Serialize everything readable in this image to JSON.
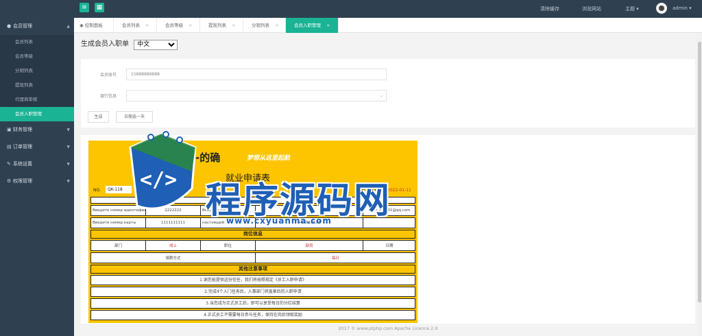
{
  "topbar": {
    "links": [
      "清除缓存",
      "浏览网站",
      "主题"
    ],
    "theme_caret": "▾",
    "user_name": "admin",
    "user_caret": "▾"
  },
  "sidebar": {
    "groups": [
      {
        "label": "会员管理",
        "icon": "user-icon",
        "expanded": true,
        "items": [
          "会员列表",
          "会员等级",
          "分销列表",
          "提现列表",
          "代理商审核",
          "会员入职管理"
        ]
      },
      {
        "label": "财务管理",
        "icon": "finance-icon"
      },
      {
        "label": "订单管理",
        "icon": "order-icon"
      },
      {
        "label": "系统设置",
        "icon": "wrench-icon"
      },
      {
        "label": "权限管理",
        "icon": "gear-icon"
      }
    ],
    "active_item": "会员入职管理"
  },
  "tabs": [
    {
      "label": "控制面板",
      "active": false,
      "icon": "home-icon"
    },
    {
      "label": "会员列表",
      "active": false
    },
    {
      "label": "会员等级",
      "active": false
    },
    {
      "label": "提现列表",
      "active": false
    },
    {
      "label": "分销列表",
      "active": false
    },
    {
      "label": "会员入职管理",
      "active": true
    }
  ],
  "page": {
    "title": "生成会员入职单",
    "language_selected": "中文"
  },
  "form": {
    "account_label": "会员账号",
    "account_value": "15888888888",
    "bank_label": "银行信息",
    "bank_value": "",
    "generate_button": "生成",
    "sign_button": "日期选一天"
  },
  "doc": {
    "brand": "-的确",
    "slogan": "梦想从这里起航",
    "title": "就业申请表",
    "no_label": "NO.",
    "no_value": "QK-118",
    "date_label": "申请日期:",
    "date_value": "2022-01-11",
    "row1": [
      "Введите номер идентификации",
      "2222222",
      "Введите почту",
      "1111182181@qq.com"
    ],
    "row2": [
      "Введите номер карты",
      "1111111111",
      "настоящий",
      "+63816534"
    ],
    "section1": "岗位信息",
    "row3": [
      "部门",
      "线上",
      "职位",
      "部员",
      "日期"
    ],
    "row4": [
      "填薪方式",
      "每日"
    ],
    "section2": "其他注意事项",
    "notes": [
      "1.谢您能提供这份信任，我们将按照规定《员工入职申请》",
      "2.完成4个入门任务后，入事部门将盖章后的入职申请",
      "3.当您成为正式员工后，即可以享受每日的分红结算",
      "4.正式员工不需要每日参与任务，保持在岗后领取奖励"
    ]
  },
  "watermark": {
    "text": "程序源码网",
    "url": "www.cxyuanma.com"
  },
  "footer": "2017 © www.ptphp.com  Apache Licence 2.0",
  "colors": {
    "sidebar_bg": "#2f4050",
    "accent": "#1ab394",
    "doc_yellow": "#fcc500",
    "watermark_blue": "#1f5fb5"
  }
}
